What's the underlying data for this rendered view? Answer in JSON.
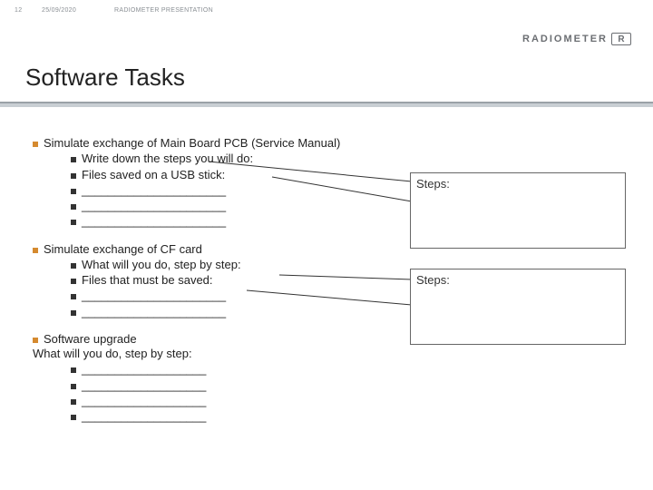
{
  "header": {
    "page_number": "12",
    "date": "25/09/2020",
    "deck_title": "RADIOMETER PRESENTATION"
  },
  "brand": {
    "name": "RADIOMETER",
    "mark": "R"
  },
  "title": "Software Tasks",
  "tasks": [
    {
      "heading": "Simulate exchange of Main Board PCB (Service Manual)",
      "subs": [
        "Write down the steps you will do:",
        "Files saved on a USB stick:",
        "______________________",
        "______________________",
        "______________________"
      ]
    },
    {
      "heading": "Simulate exchange of CF card",
      "subs": [
        "What will you do, step by step:",
        "Files that must be saved:",
        "______________________",
        "______________________"
      ]
    },
    {
      "heading": "Software upgrade",
      "continuation": "What will you do, step by step:",
      "subs": [
        "___________________",
        "___________________",
        "___________________",
        "___________________"
      ]
    }
  ],
  "steps_boxes": [
    {
      "label": "Steps:"
    },
    {
      "label": "Steps:"
    }
  ]
}
